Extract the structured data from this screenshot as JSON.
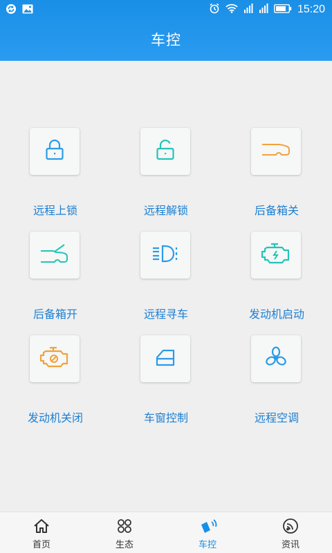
{
  "status_bar": {
    "time": "15:20",
    "left_icons": [
      "sync-icon",
      "image-icon"
    ],
    "right_icons": [
      "alarm-icon",
      "wifi-icon",
      "signal-icon",
      "signal-icon",
      "battery-icon"
    ]
  },
  "header": {
    "title": "车控"
  },
  "controls": [
    {
      "label": "远程上锁",
      "icon": "lock-icon",
      "color": "#2a9be8"
    },
    {
      "label": "远程解锁",
      "icon": "unlock-icon",
      "color": "#22c4b8"
    },
    {
      "label": "后备箱关",
      "icon": "trunk-close-icon",
      "color": "#f0a23a"
    },
    {
      "label": "后备箱开",
      "icon": "trunk-open-icon",
      "color": "#22c4b8"
    },
    {
      "label": "远程寻车",
      "icon": "headlight-icon",
      "color": "#2a9be8"
    },
    {
      "label": "发动机启动",
      "icon": "engine-start-icon",
      "color": "#22c4b8"
    },
    {
      "label": "发动机关闭",
      "icon": "engine-stop-icon",
      "color": "#f0a23a"
    },
    {
      "label": "车窗控制",
      "icon": "window-icon",
      "color": "#2a9be8"
    },
    {
      "label": "远程空调",
      "icon": "fan-icon",
      "color": "#2a9be8"
    }
  ],
  "bottom_nav": [
    {
      "label": "首页",
      "icon": "home-icon"
    },
    {
      "label": "生态",
      "icon": "ecosystem-icon"
    },
    {
      "label": "车控",
      "icon": "car-control-icon",
      "active": true
    },
    {
      "label": "资讯",
      "icon": "news-icon"
    }
  ],
  "colors": {
    "accent": "#1a8fe6",
    "label": "#1c7fd1",
    "background": "#efeff0"
  }
}
